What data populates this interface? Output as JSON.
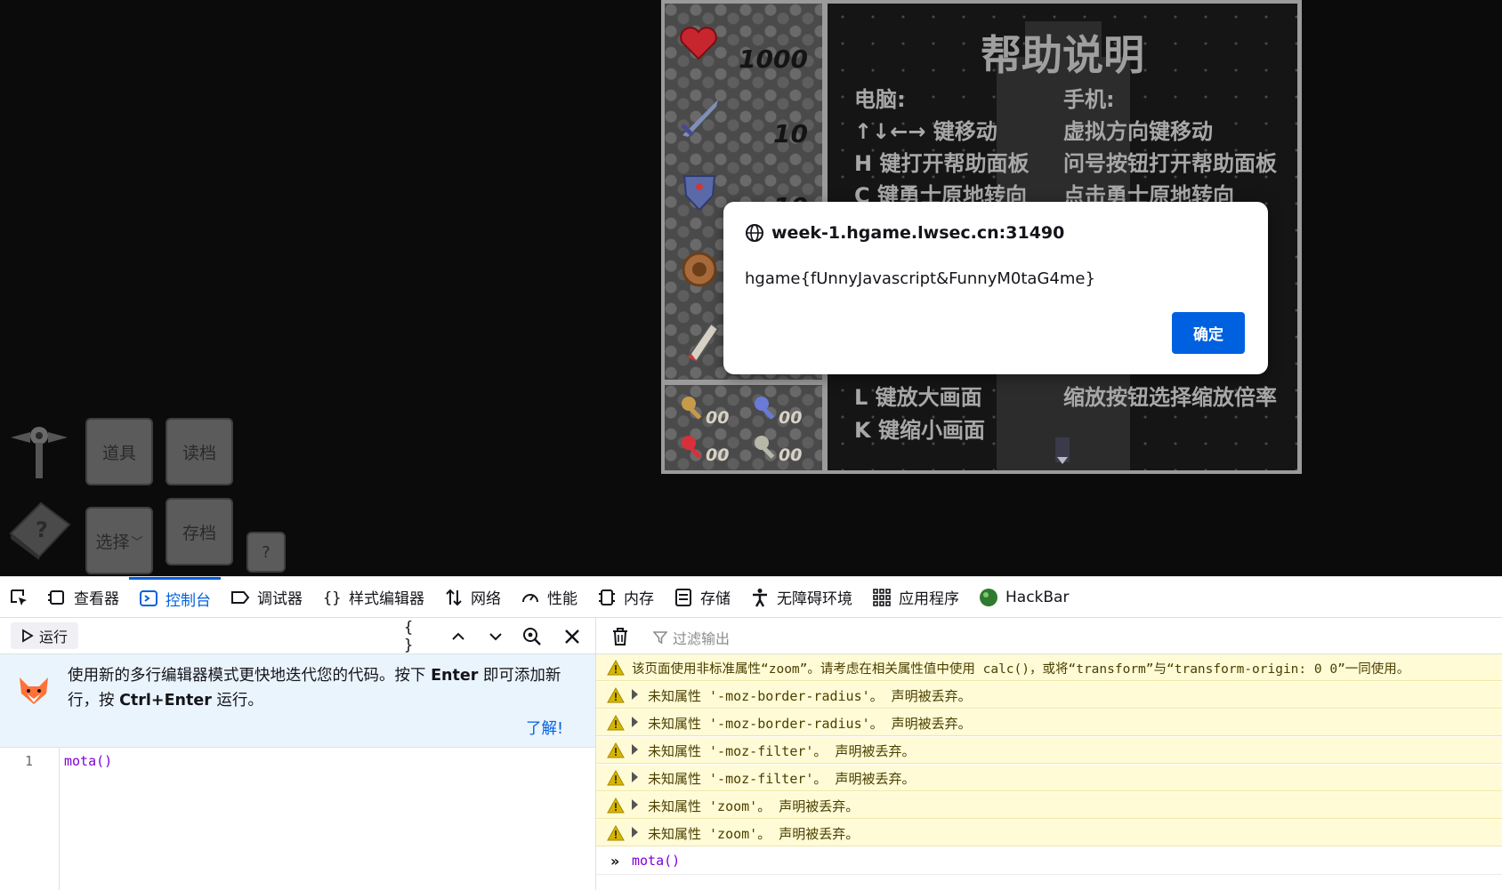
{
  "game": {
    "buttons": {
      "items": "道具",
      "load": "读档",
      "select": "选择",
      "save": "存档",
      "help": "?"
    },
    "stats": {
      "hp": "1000",
      "atk": "10",
      "def": "10"
    },
    "keys": {
      "yellow": "00",
      "blue": "00",
      "red": "00",
      "green": "00"
    },
    "help_panel": {
      "title": "帮助说明",
      "pc_header": "电脑:",
      "mobile_header": "手机:",
      "pc_lines": [
        "↑↓←→ 键移动",
        "H 键打开帮助面板",
        "C 键勇士原地转向",
        "L 键放大画面",
        "K 键缩小画面"
      ],
      "mobile_lines": [
        "虚拟方向键移动",
        "问号按钮打开帮助面板",
        "点击勇士原地转向",
        "缩放按钮选择缩放倍率"
      ]
    }
  },
  "dialog": {
    "origin": "week-1.hgame.lwsec.cn:31490",
    "message": "hgame{fUnnyJavascript&FunnyM0taG4me}",
    "ok_label": "确定"
  },
  "devtools": {
    "tabs": [
      {
        "label": "查看器",
        "icon": "inspector-icon"
      },
      {
        "label": "控制台",
        "icon": "console-icon",
        "selected": true
      },
      {
        "label": "调试器",
        "icon": "debugger-icon"
      },
      {
        "label": "样式编辑器",
        "icon": "style-editor-icon"
      },
      {
        "label": "网络",
        "icon": "network-icon"
      },
      {
        "label": "性能",
        "icon": "performance-icon"
      },
      {
        "label": "内存",
        "icon": "memory-icon"
      },
      {
        "label": "存储",
        "icon": "storage-icon"
      },
      {
        "label": "无障碍环境",
        "icon": "accessibility-icon"
      },
      {
        "label": "应用程序",
        "icon": "application-icon"
      },
      {
        "label": "HackBar",
        "icon": "hackbar-icon"
      }
    ],
    "editor": {
      "run_label": "运行",
      "notice_prefix": "使用新的多行编辑器模式更快地迭代您的代码。按下 ",
      "notice_enter": "Enter",
      "notice_mid": " 即可添加新行，按 ",
      "notice_ctrl": "Ctrl+Enter",
      "notice_suffix": " 运行。",
      "learn_label": "了解!",
      "line_number": "1",
      "code": "mota()"
    },
    "output": {
      "filter_placeholder": "过滤输出",
      "messages": [
        "该页面使用非标准属性“zoom”。请考虑在相关属性值中使用 calc()，或将“transform”与“transform-origin: 0 0”一同使用。",
        "未知属性 '-moz-border-radius'。  声明被丢弃。",
        "未知属性 '-moz-border-radius'。  声明被丢弃。",
        "未知属性 '-moz-filter'。  声明被丢弃。",
        "未知属性 '-moz-filter'。  声明被丢弃。",
        "未知属性 'zoom'。  声明被丢弃。",
        "未知属性 'zoom'。  声明被丢弃。"
      ],
      "last_input": "mota()"
    },
    "colors": {
      "accent": "#0061e0",
      "warning_bg": "#fffbd6",
      "warning_icon": "#d7b600"
    }
  }
}
